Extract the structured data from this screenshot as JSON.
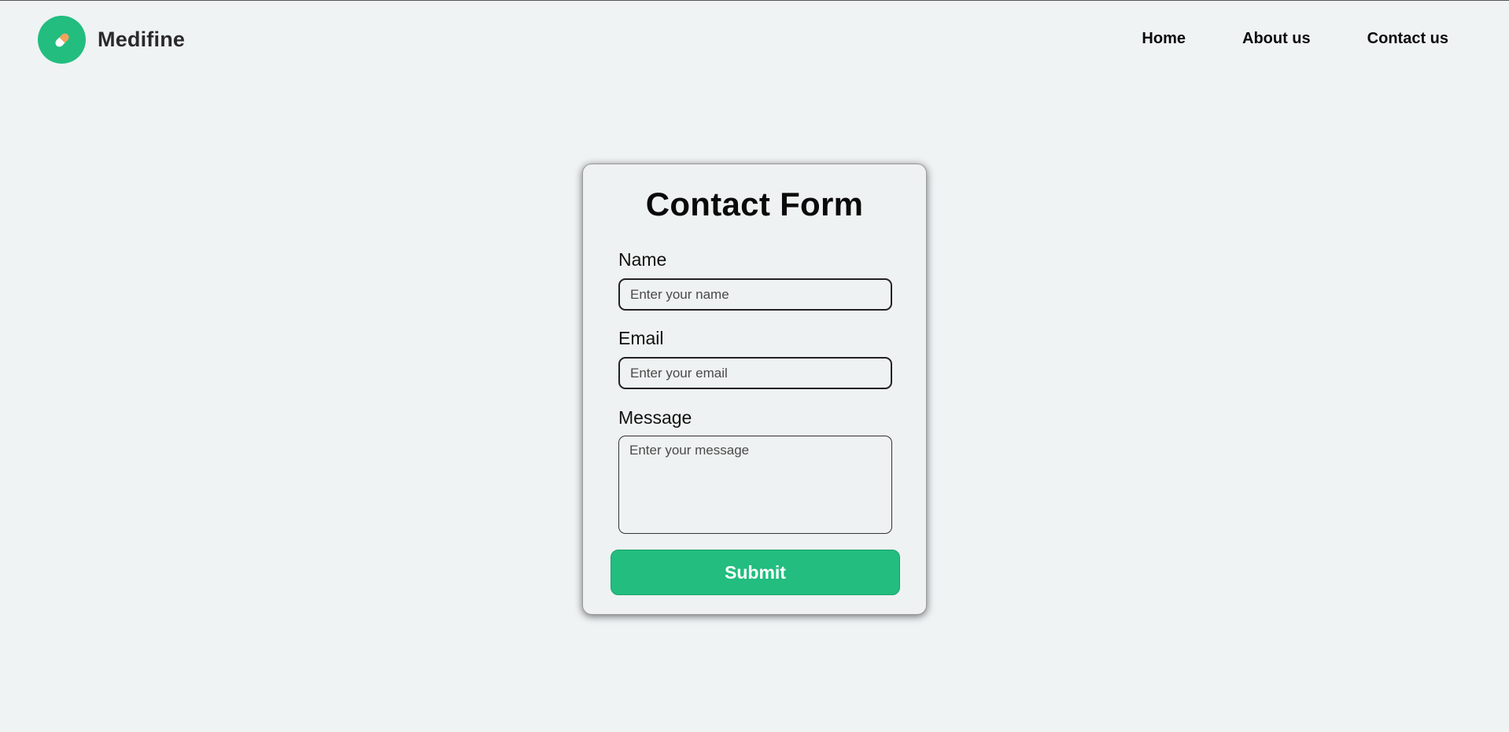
{
  "colors": {
    "page_background": "#eff3f4",
    "accent": "#22bd7f",
    "pill_light": "#ffffff",
    "pill_orange": "#f4a35d"
  },
  "header": {
    "logo_icon": "pill-icon",
    "brand_name": "Medifine",
    "nav": [
      {
        "label": "Home"
      },
      {
        "label": "About us"
      },
      {
        "label": "Contact us"
      }
    ]
  },
  "form": {
    "title": "Contact Form",
    "name": {
      "label": "Name",
      "placeholder": "Enter your name"
    },
    "email": {
      "label": "Email",
      "placeholder": "Enter your email"
    },
    "message": {
      "label": "Message",
      "placeholder": "Enter your message"
    },
    "submit_label": "Submit"
  }
}
